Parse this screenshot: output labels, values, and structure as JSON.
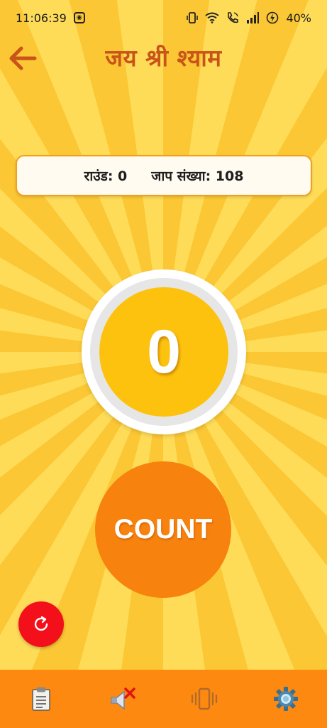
{
  "status_bar": {
    "time": "11:06:39",
    "battery": "40%",
    "icons": [
      "app-notification-icon",
      "vibrate-icon",
      "wifi-icon",
      "wifi-call-icon",
      "signal-icon",
      "battery-charging-icon"
    ]
  },
  "header": {
    "title": "जय श्री श्याम",
    "back_icon": "arrow-left-icon"
  },
  "info": {
    "round_label": "राउंड: 0",
    "jaap_label": "जाप संख्या: 108"
  },
  "counter": {
    "value": "0"
  },
  "count_button": {
    "label": "COUNT"
  },
  "reset_button": {
    "icon": "refresh-icon"
  },
  "bottom_nav": {
    "items": [
      "clipboard-icon",
      "sound-off-icon",
      "vibration-icon",
      "settings-gear-icon"
    ]
  },
  "colors": {
    "background": "#fdd23c",
    "title": "#c8541a",
    "counter_fill": "#fdc20e",
    "count_button": "#f8820e",
    "reset_button": "#f4101a",
    "bottom_bar": "#fd8910"
  }
}
